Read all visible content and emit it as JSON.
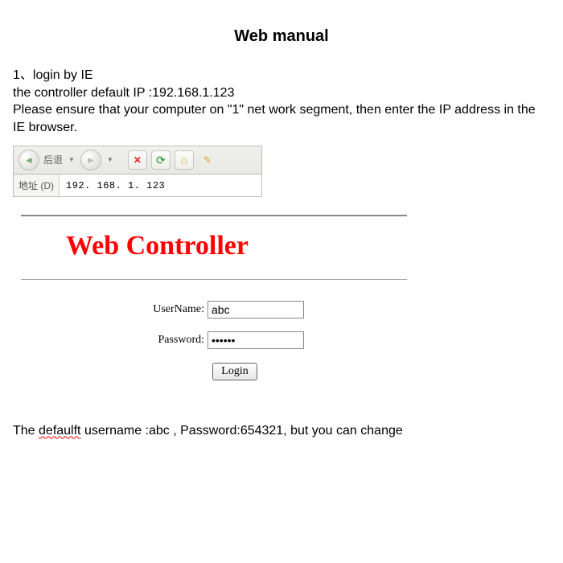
{
  "title": "Web manual",
  "intro": {
    "line1": "1、login by IE",
    "line2": "the controller default IP :192.168.1.123",
    "line3": "Please ensure that your computer on \"1\" net work segment, then enter the IP address in the IE browser."
  },
  "toolbar": {
    "back_label": "后退",
    "addr_label": "地址 (D)",
    "addr_value": "192. 168. 1. 123"
  },
  "login": {
    "header": "Web Controller",
    "user_label": "UserName:",
    "pass_label": "Password:",
    "user_value": "abc",
    "pass_value": "••••••",
    "login_btn": "Login"
  },
  "footer": {
    "prefix": "The ",
    "wavy": "defaulft",
    "rest": " username :abc , Password:654321, but you can change"
  }
}
